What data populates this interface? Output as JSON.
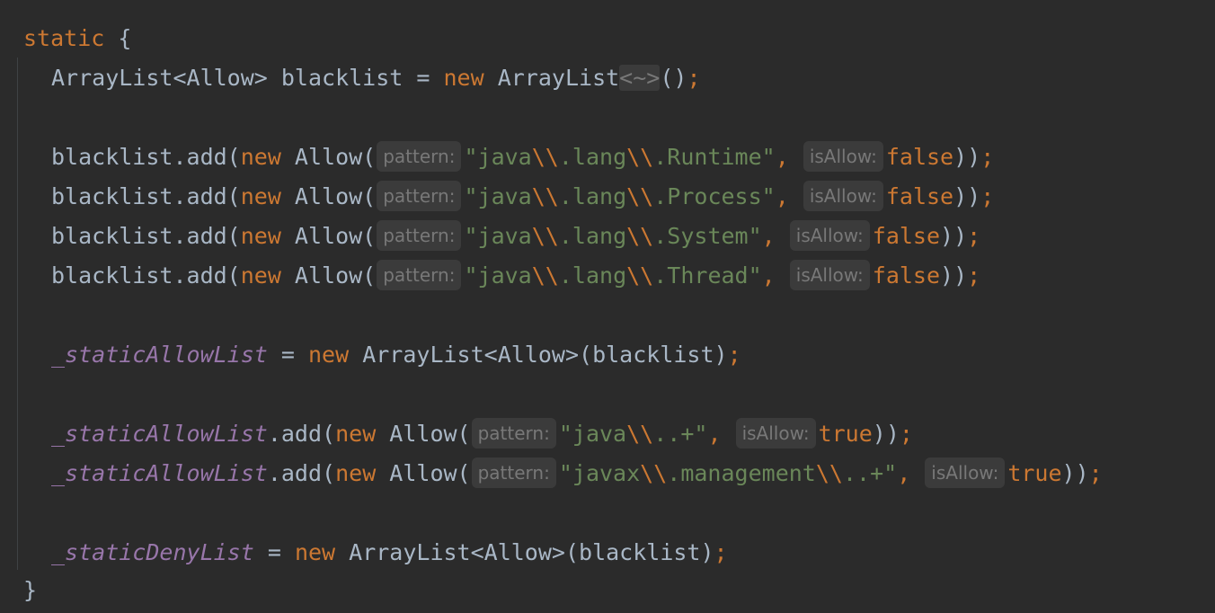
{
  "code": {
    "kw_static": "static",
    "open_brace": " {",
    "close_brace": "}",
    "kw_new": "new",
    "arraylist_decl": "ArrayList<Allow> blacklist = ",
    "arraylist_ctor": " ArrayList",
    "diamond": "<~>",
    "parens": "()",
    "semicolon": ";",
    "bl_add_prefix": "blacklist.add(",
    "allow_open": " Allow(",
    "hint_pattern": "pattern:",
    "hint_isallow": "isAllow:",
    "comma": ", ",
    "kw_false": "false",
    "kw_true": "true",
    "close_call": "))",
    "quote": "\"",
    "esc": "\\\\",
    "java": "java",
    "javax": "javax",
    "dot_lang": ".lang",
    "dot_runtime": ".Runtime",
    "dot_process": ".Process",
    "dot_system": ".System",
    "dot_thread": ".Thread",
    "dot_management": ".management",
    "dot_dot_plus": "..+",
    "static_allow_list": "_staticAllowList",
    "static_deny_list": "_staticDenyList",
    "assign_eq": " = ",
    "arraylist_allow": " ArrayList<Allow>(blacklist)",
    "dot_add": ".add("
  }
}
